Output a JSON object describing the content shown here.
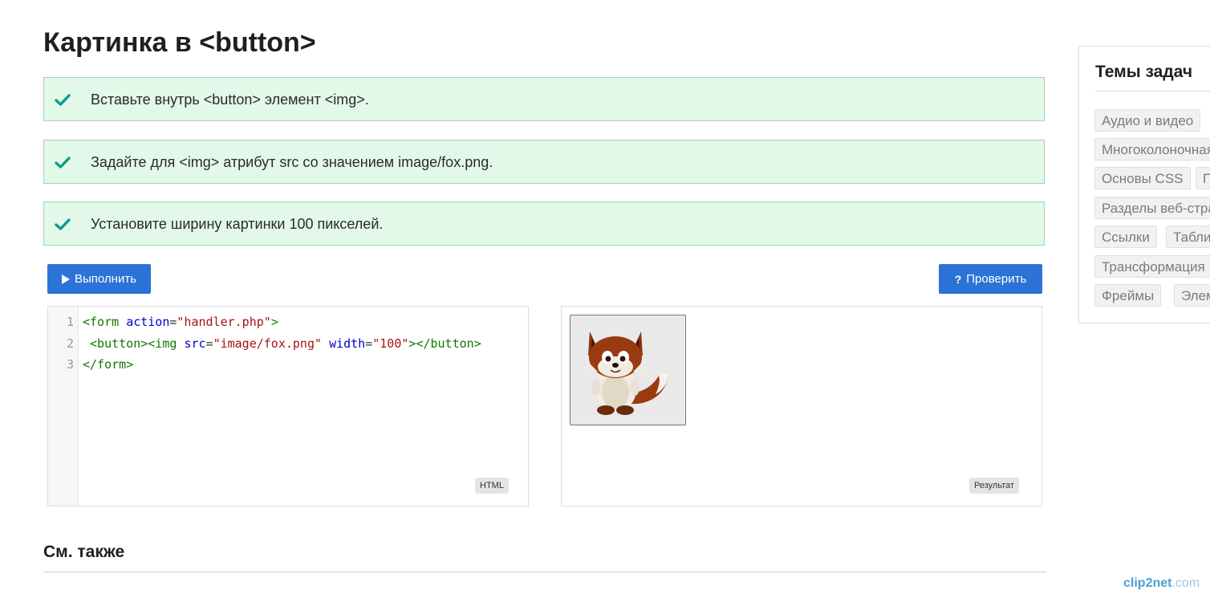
{
  "page": {
    "title": "Картинка в <button>",
    "see_also": "См. также"
  },
  "tasks": [
    {
      "text": "Вставьте внутрь <button> элемент <img>.",
      "done": true
    },
    {
      "text": "Задайте для <img> атрибут src со значением image/fox.png.",
      "done": true
    },
    {
      "text": "Установите ширину картинки 100 пикселей.",
      "done": true
    }
  ],
  "toolbar": {
    "run_label": "Выполнить",
    "check_label": "Проверить"
  },
  "editor": {
    "line_numbers": [
      "1",
      "2",
      "3"
    ],
    "lang_badge": "HTML",
    "lines": [
      "<form action=\"handler.php\">",
      " <button><img src=\"image/fox.png\" width=\"100\"></button>",
      "</form>"
    ]
  },
  "result": {
    "badge": "Результат",
    "image": "fox-cartoon"
  },
  "sidebar": {
    "title": "Темы задач",
    "topics": [
      "Аудио и видео",
      "Многоколоночная",
      "Основы CSS",
      "П",
      "Разделы веб-стра",
      "Ссылки",
      "Табли",
      "Трансформация",
      "Фреймы",
      "Элем"
    ]
  },
  "watermark": {
    "brand": "clip2net",
    "suffix": ".com"
  },
  "colors": {
    "accent": "#2c73d8",
    "task_bg": "#e2f8e9",
    "check": "#129a8a"
  }
}
